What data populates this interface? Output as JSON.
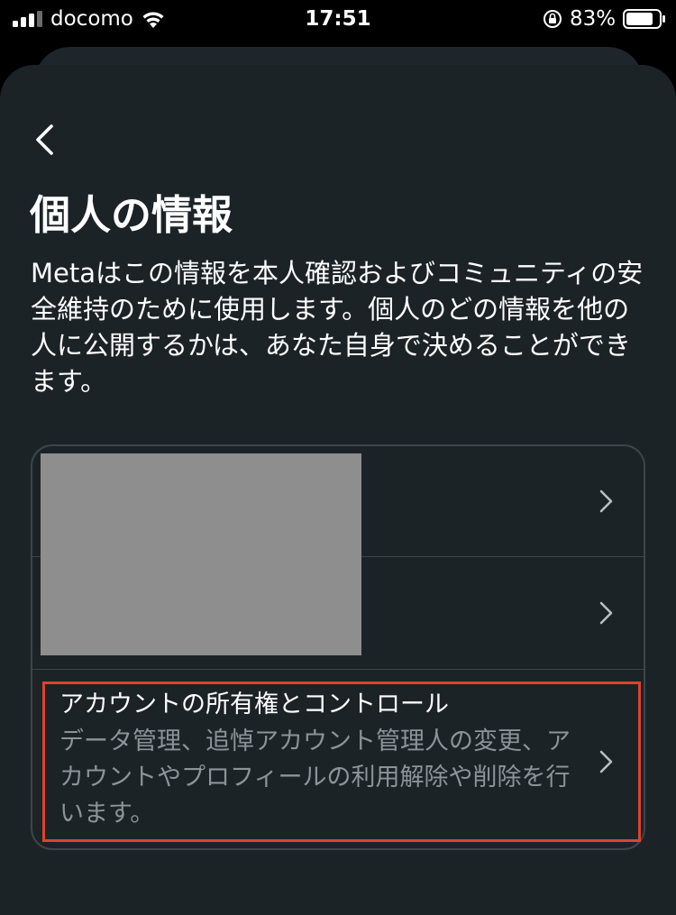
{
  "status_bar": {
    "carrier": "docomo",
    "time": "17:51",
    "battery_percent": "83%",
    "battery_level": 0.83,
    "icons": [
      "signal-icon",
      "wifi-icon",
      "rotation-lock-icon",
      "battery-icon"
    ]
  },
  "page": {
    "title": "個人の情報",
    "description": "Metaはこの情報を本人確認およびコミュニティの安全維持のために使用します。個人のどの情報を他の人に公開するかは、あなた自身で決めることができます。"
  },
  "list": {
    "items": [
      {
        "title": "",
        "subtitle": ""
      },
      {
        "title": "",
        "subtitle": ""
      },
      {
        "title": "アカウントの所有権とコントロール",
        "subtitle": "データ管理、追悼アカウント管理人の変更、アカウントやプロフィールの利用解除や削除を行います。"
      }
    ]
  },
  "colors": {
    "background": "#1c2327",
    "divider": "#3b464c",
    "secondary_text": "#8a9499",
    "highlight": "#e0422c",
    "redaction": "#8e8e8e"
  }
}
